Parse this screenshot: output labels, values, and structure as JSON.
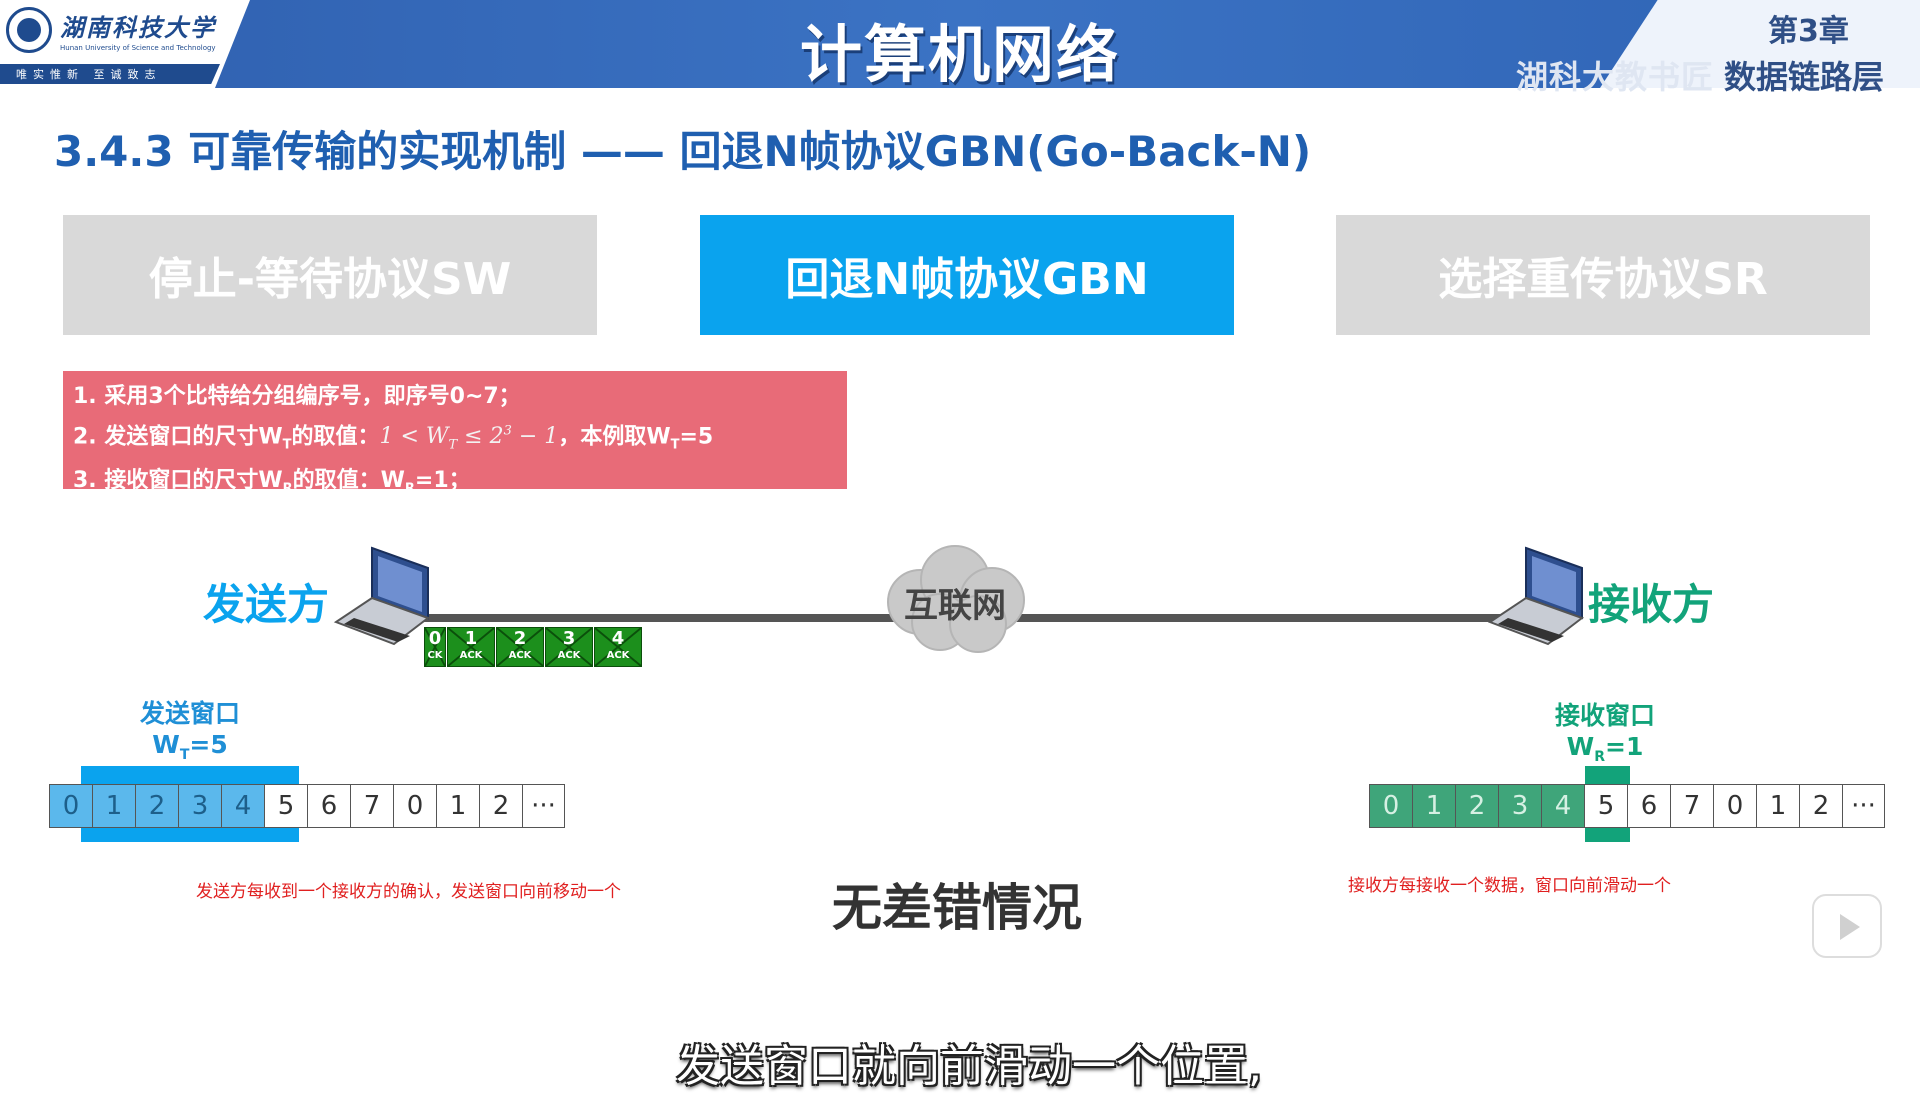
{
  "header": {
    "logo_name": "湖南科技大学",
    "logo_en": "Hunan University of Science and Technology",
    "logo_motto": "唯实惟新 至诚致志",
    "title": "计算机网络",
    "chapter": "第3章",
    "chapter_sub": "湖科大教书匠",
    "chapter_name": "数据链路层"
  },
  "section_title": "3.4.3 可靠传输的实现机制 —— 回退N帧协议GBN(Go-Back-N)",
  "tabs": [
    {
      "label": "停止-等待协议SW",
      "active": false
    },
    {
      "label": "回退N帧协议GBN",
      "active": true
    },
    {
      "label": "选择重传协议SR",
      "active": false
    }
  ],
  "rules": {
    "r1": "1. 采用3个比特给分组编序号，即序号0~7；",
    "r2_prefix": "2. 发送窗口的尺寸W",
    "r2_sub": "T",
    "r2_mid": "的取值：",
    "r2_math_a": "1 < W",
    "r2_math_sub": "T",
    "r2_math_b": " ≤ 2",
    "r2_math_sup": "3",
    "r2_math_c": " − 1",
    "r2_suffix_a": "，本例取W",
    "r2_suffix_sub": "T",
    "r2_suffix_b": "=5",
    "r3_prefix": "3. 接收窗口的尺寸W",
    "r3_sub": "R",
    "r3_mid": "的取值：W",
    "r3_sub2": "R",
    "r3_suffix": "=1；"
  },
  "network": {
    "sender": "发送方",
    "receiver": "接收方",
    "internet": "互联网",
    "acks": [
      {
        "num": "0",
        "text": "CK"
      },
      {
        "num": "1",
        "text": "ACK"
      },
      {
        "num": "2",
        "text": "ACK"
      },
      {
        "num": "3",
        "text": "ACK"
      },
      {
        "num": "4",
        "text": "ACK"
      }
    ]
  },
  "send_window": {
    "title": "发送窗口",
    "size_prefix": "W",
    "size_sub": "T",
    "size_suffix": "=5",
    "cells": [
      "0",
      "1",
      "2",
      "3",
      "4",
      "5",
      "6",
      "7",
      "0",
      "1",
      "2",
      "···"
    ],
    "highlighted_count": 5,
    "note": "发送方每收到一个接收方的确认，发送窗口向前移动一个"
  },
  "recv_window": {
    "title": "接收窗口",
    "size_prefix": "W",
    "size_sub": "R",
    "size_suffix": "=1",
    "cells": [
      "0",
      "1",
      "2",
      "3",
      "4",
      "5",
      "6",
      "7",
      "0",
      "1",
      "2",
      "···"
    ],
    "received_count": 5,
    "note": "接收方每接收一个数据，窗口向前滑动一个"
  },
  "status": "无差错情况",
  "subtitle": "发送窗口就向前滑动一个位置,",
  "colors": {
    "header_blue": "#2f5fae",
    "accent_blue": "#0aa3ee",
    "accent_green": "#12a37a",
    "rules_pink": "#e86b78",
    "note_red": "#e02020"
  }
}
